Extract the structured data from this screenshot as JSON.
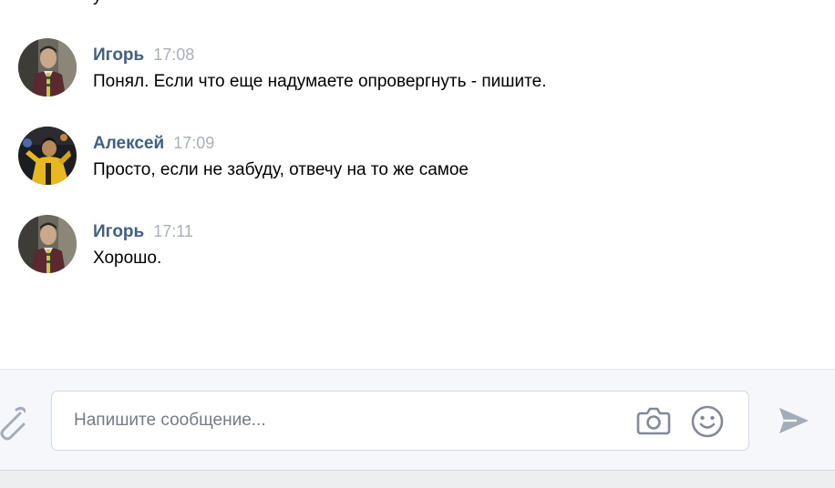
{
  "history": {
    "cut_glyph": "у",
    "messages": [
      {
        "author": "Игорь",
        "time": "17:08",
        "text": "Понял. Если что еще надумаете опровергнуть - пишите.",
        "avatar": "igor-avatar"
      },
      {
        "author": "Алексей",
        "time": "17:09",
        "text": "Просто, если не забуду, отвечу на то же самое",
        "avatar": "aleksey-avatar"
      },
      {
        "author": "Игорь",
        "time": "17:11",
        "text": "Хорошо.",
        "avatar": "igor-avatar"
      }
    ]
  },
  "composer": {
    "placeholder": "Напишите сообщение...",
    "icons": {
      "attach": "paperclip-icon",
      "camera": "camera-icon",
      "emoji": "smile-icon",
      "send": "send-icon"
    }
  },
  "colors": {
    "author": "#3f5f83",
    "time": "#a9b0b9",
    "icon": "#828a99",
    "composer_bg": "#f5f7fa"
  }
}
